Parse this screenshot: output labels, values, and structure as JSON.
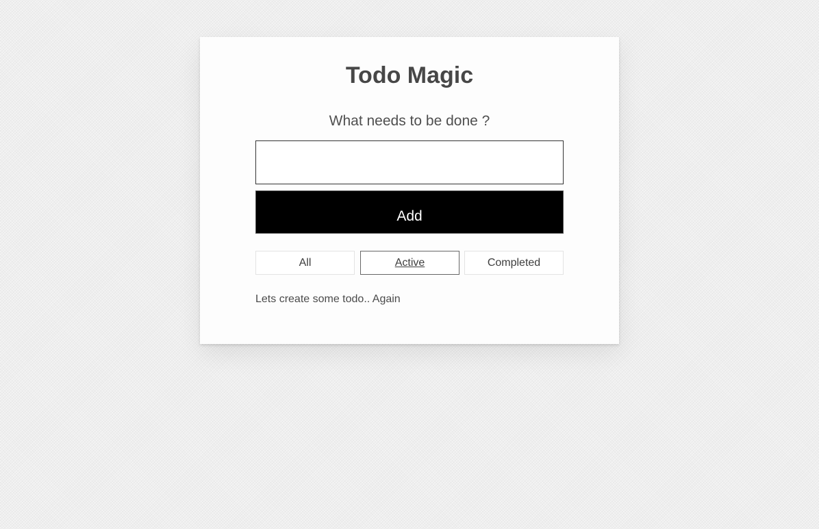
{
  "app": {
    "title": "Todo Magic",
    "prompt": "What needs to be done ?"
  },
  "input": {
    "value": "",
    "placeholder": ""
  },
  "add_button": {
    "label": "Add"
  },
  "filters": [
    {
      "label": "All",
      "selected": false
    },
    {
      "label": "Active",
      "selected": true
    },
    {
      "label": "Completed",
      "selected": false
    }
  ],
  "status_message": "Lets create some todo.. Again",
  "colors": {
    "add_button_bg": "#000000",
    "add_button_text": "#ffffff",
    "text": "#4d4d4d"
  }
}
